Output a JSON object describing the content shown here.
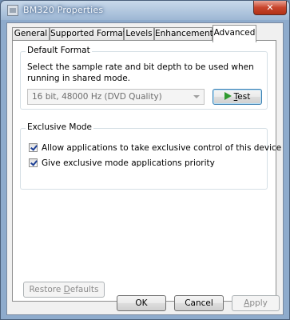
{
  "window": {
    "title": "BM320 Properties",
    "close_glyph": "✕"
  },
  "tabs": [
    {
      "label": "General",
      "active": false
    },
    {
      "label": "Supported Formats",
      "active": false
    },
    {
      "label": "Levels",
      "active": false
    },
    {
      "label": "Enhancements",
      "active": false
    },
    {
      "label": "Advanced",
      "active": true
    }
  ],
  "default_format": {
    "group_label": "Default Format",
    "description": "Select the sample rate and bit depth to be used when running in shared mode.",
    "selected_format": "16 bit, 48000 Hz (DVD Quality)",
    "test_button": {
      "mnemonic": "T",
      "rest": "est",
      "icon": "play-icon"
    }
  },
  "exclusive_mode": {
    "group_label": "Exclusive Mode",
    "options": [
      {
        "label": "Allow applications to take exclusive control of this device",
        "checked": true
      },
      {
        "label": "Give exclusive mode applications priority",
        "checked": true
      }
    ]
  },
  "restore_defaults": {
    "prefix": "Restore ",
    "mnemonic": "D",
    "rest": "efaults",
    "enabled": false
  },
  "footer": {
    "ok_label": "OK",
    "cancel_label": "Cancel",
    "apply_mnemonic": "A",
    "apply_rest": "pply",
    "apply_enabled": false
  },
  "colors": {
    "title_text": "#f4f7fb",
    "accent_play": "#2f9a2f",
    "check_mark": "#1c3f94"
  }
}
